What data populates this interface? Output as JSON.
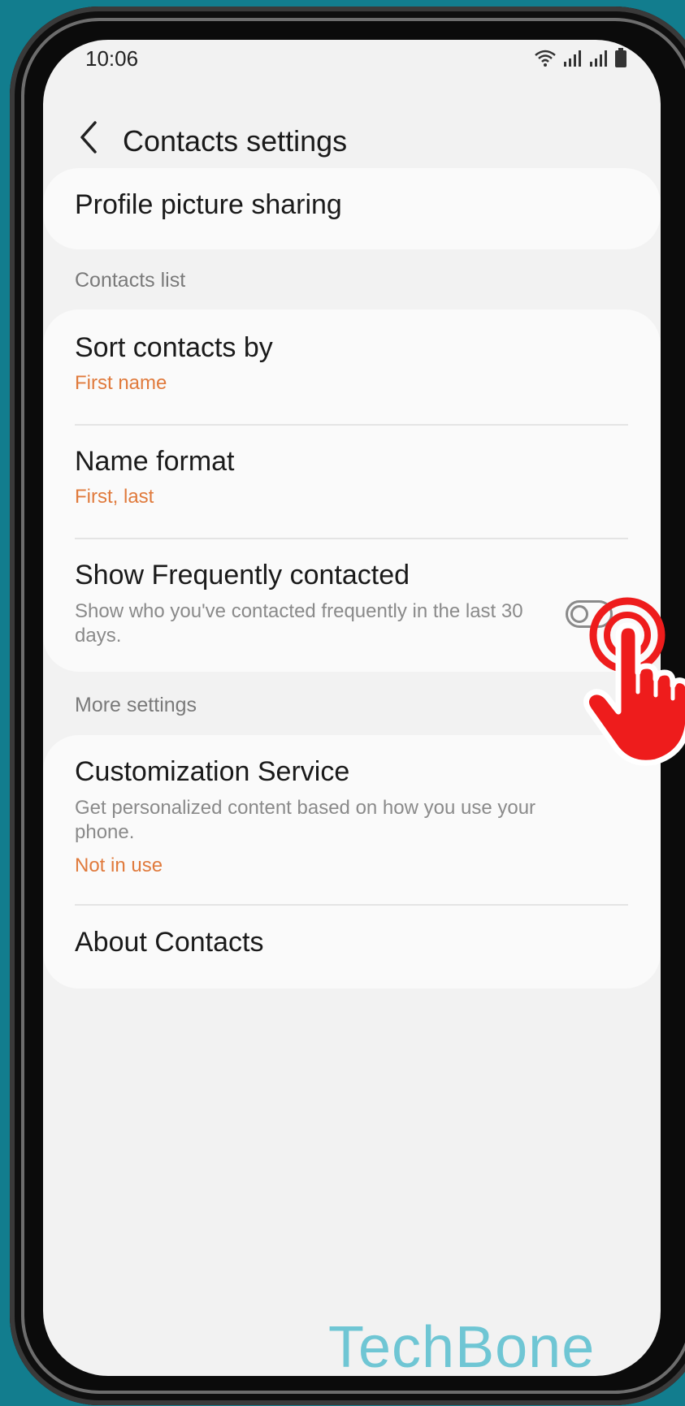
{
  "status_bar": {
    "time": "10:06",
    "icons": [
      "wifi-icon",
      "signal-icon",
      "signal-icon",
      "battery-icon"
    ]
  },
  "app_bar": {
    "back_icon": "chevron-left-icon",
    "title": "Contacts settings"
  },
  "profile_card": {
    "title": "Profile picture sharing"
  },
  "contacts_list": {
    "header": "Contacts list",
    "items": [
      {
        "title": "Sort contacts by",
        "value": "First name"
      },
      {
        "title": "Name format",
        "value": "First, last"
      },
      {
        "title": "Show Frequently contacted",
        "description": "Show who you've contacted frequently in the last 30 days.",
        "toggle_on": false
      }
    ]
  },
  "more_settings": {
    "header": "More settings",
    "items": [
      {
        "title": "Customization Service",
        "description": "Get personalized content based on how you use your phone.",
        "value": "Not in use"
      },
      {
        "title": "About Contacts"
      }
    ]
  },
  "overlay": {
    "hand_icon": "tap-hand-icon"
  },
  "watermark": "TechBone",
  "colors": {
    "background": "#127d8e",
    "screen": "#f2f2f2",
    "card": "#fafafa",
    "accent": "#e07a3c",
    "watermark": "#6fc6d4",
    "hand": "#ee1c1c"
  }
}
